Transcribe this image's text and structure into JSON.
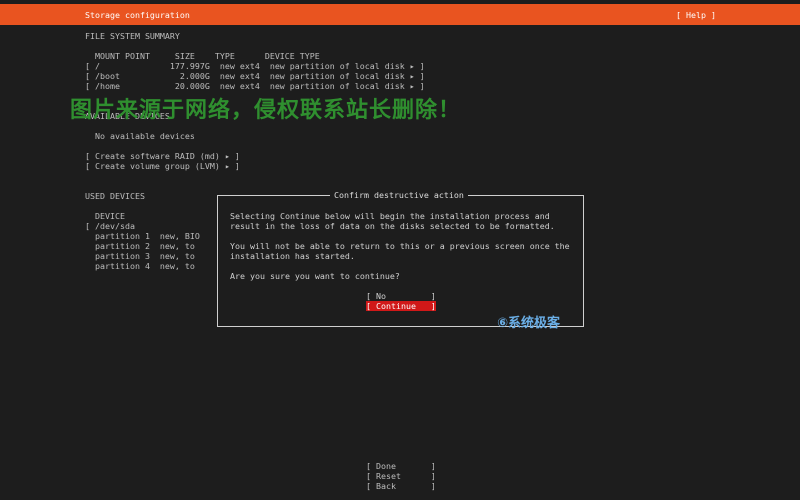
{
  "header": {
    "title": "Storage configuration",
    "help": "[ Help ]"
  },
  "fs_summary": {
    "heading": "FILE SYSTEM SUMMARY",
    "columns": "  MOUNT POINT     SIZE    TYPE      DEVICE TYPE",
    "rows": [
      "[ /              177.997G  new ext4  new partition of local disk ▸ ]",
      "[ /boot            2.000G  new ext4  new partition of local disk ▸ ]",
      "[ /home           20.000G  new ext4  new partition of local disk ▸ ]"
    ]
  },
  "available": {
    "heading": "AVAILABLE DEVICES",
    "empty": "  No available devices",
    "actions": [
      "[ Create software RAID (md) ▸ ]",
      "[ Create volume group (LVM) ▸ ]"
    ]
  },
  "used": {
    "heading": "USED DEVICES",
    "column": "  DEVICE",
    "rows": [
      "[ /dev/sda",
      "  partition 1  new, BIO",
      "  partition 2  new, to",
      "  partition 3  new, to",
      "  partition 4  new, to"
    ]
  },
  "dialog": {
    "title": "Confirm destructive action",
    "line1": "Selecting Continue below will begin the installation process and",
    "line2": "result in the loss of data on the disks selected to be formatted.",
    "line3": "You will not be able to return to this or a previous screen once the",
    "line4": "installation has started.",
    "line5": "Are you sure you want to continue?",
    "no": "[ No         ]",
    "continue": "[ Continue   ]"
  },
  "footer": {
    "done": "[ Done       ]",
    "reset": "[ Reset      ]",
    "back": "[ Back       ]"
  },
  "overlay": {
    "watermark": "图片来源于网络，侵权联系站长删除！",
    "brand": "⑥系统极客"
  },
  "colors": {
    "accent": "#e95420",
    "selected": "#d01818",
    "watermark": "#2f8f2f",
    "brand": "#6aaee6"
  }
}
